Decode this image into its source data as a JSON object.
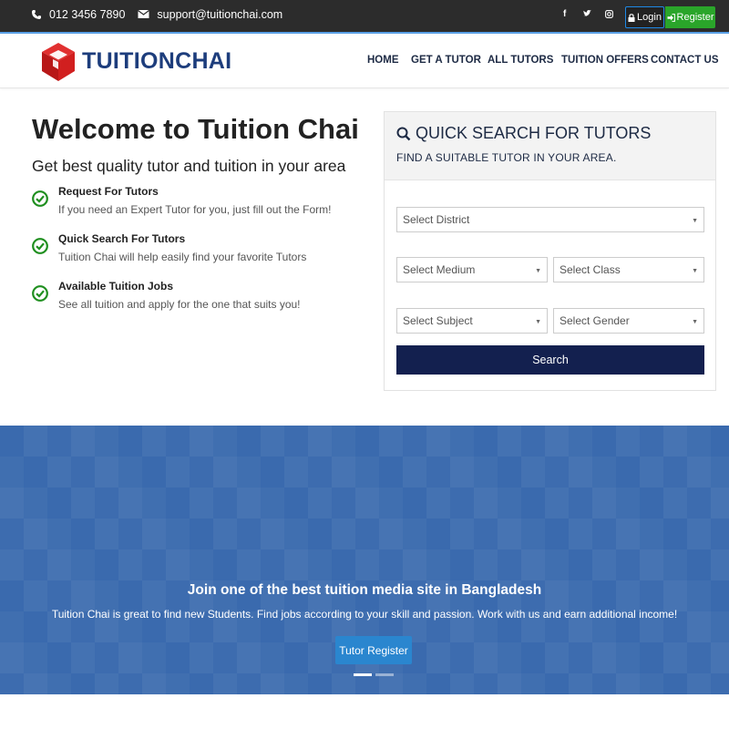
{
  "topbar": {
    "phone": "012 3456 7890",
    "email": "support@tuitionchai.com",
    "social": [
      "f",
      "t",
      "ig"
    ],
    "login_label": "Login",
    "register_label": "Register"
  },
  "header": {
    "brand": "TUITIONCHAI",
    "nav": [
      "HOME",
      "GET A TUTOR",
      "ALL TUTORS",
      "TUITION OFFERS",
      "CONTACT US"
    ]
  },
  "intro": {
    "title": "Welcome to Tuition Chai",
    "tagline": "Get best quality tutor and tuition in your area",
    "features": [
      {
        "title": "Request For Tutors",
        "desc": "If you need an Expert Tutor for you, just fill out the Form!"
      },
      {
        "title": "Quick Search For Tutors",
        "desc": "Tuition Chai will help easily find your favorite Tutors"
      },
      {
        "title": "Available Tuition Jobs",
        "desc": "See all tuition and apply for the one that suits you!"
      }
    ]
  },
  "search": {
    "title": "QUICK SEARCH FOR TUTORS",
    "subtitle": "FIND A SUITABLE TUTOR IN YOUR AREA.",
    "district": "Select District",
    "medium": "Select Medium",
    "class": "Select Class",
    "subject": "Select Subject",
    "gender": "Select Gender",
    "button": "Search"
  },
  "hero": {
    "title": "Join one of the best tuition media site in Bangladesh",
    "subtitle": "Tuition Chai is great to find new Students. Find jobs according to your skill and passion. Work with us and earn additional income!",
    "button": "Tutor Register",
    "slides_total": 2,
    "slide_active": 1
  },
  "colors": {
    "topbar": "#2c2c2c",
    "brand": "#1d3d7c",
    "logo_red": "#d11f1f",
    "check_green": "#1f8f1f",
    "search_button": "#13204f",
    "register_green": "#2aa52a",
    "hero_blue": "#3a6aae",
    "hero_button": "#2a86cf"
  },
  "icons": {
    "phone": "phone-icon",
    "email": "envelope-icon",
    "login": "lock-icon",
    "register": "sign-in-icon",
    "search": "search-icon",
    "feature": "check-circle-icon",
    "select": "caret-down-icon"
  }
}
